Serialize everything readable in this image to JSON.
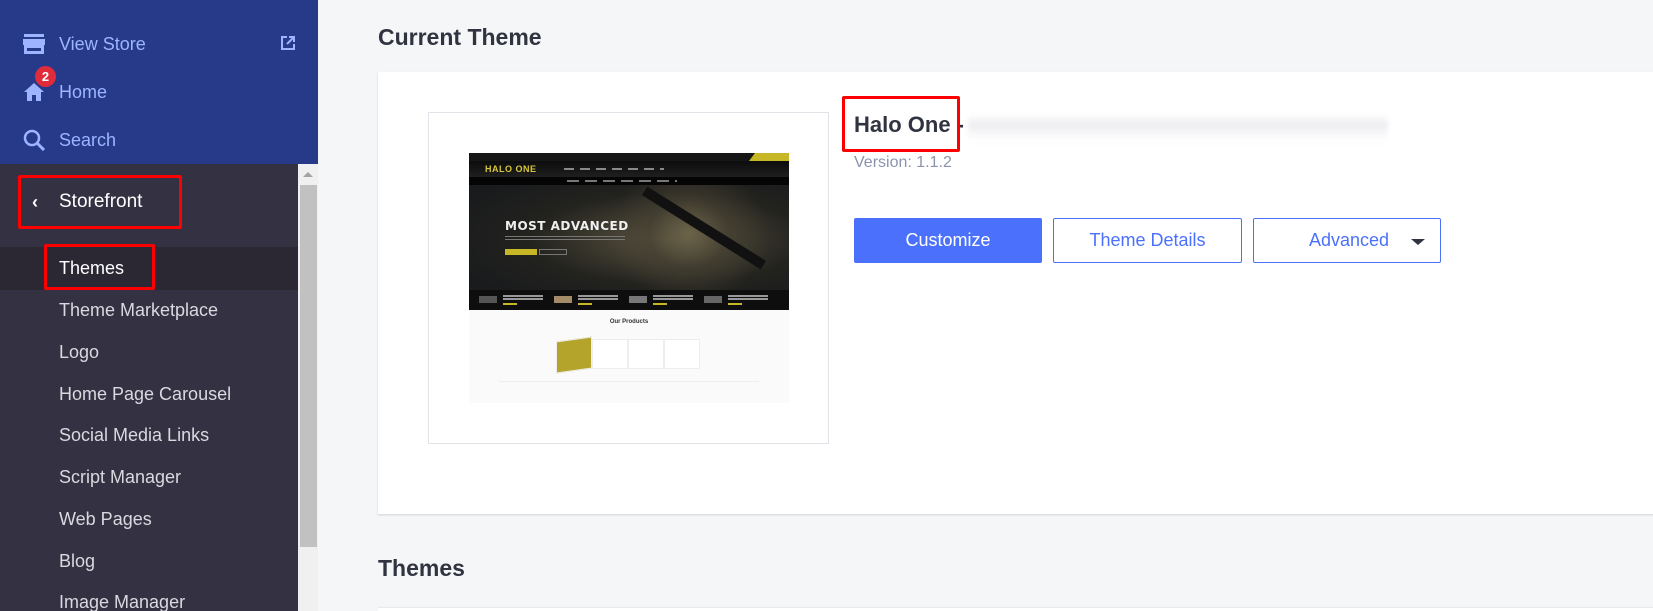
{
  "sidebar": {
    "top_items": [
      {
        "label": "View Store",
        "icon": "store-icon",
        "trailing_icon": "external-link-icon"
      },
      {
        "label": "Home",
        "icon": "home-icon",
        "badge": "2"
      },
      {
        "label": "Search",
        "icon": "search-icon"
      }
    ],
    "section": {
      "label": "Storefront",
      "back_icon": "chevron-left-icon"
    },
    "items": [
      {
        "label": "Themes",
        "active": true
      },
      {
        "label": "Theme Marketplace"
      },
      {
        "label": "Logo"
      },
      {
        "label": "Home Page Carousel"
      },
      {
        "label": "Social Media Links"
      },
      {
        "label": "Script Manager"
      },
      {
        "label": "Web Pages"
      },
      {
        "label": "Blog"
      },
      {
        "label": "Image Manager"
      }
    ]
  },
  "main": {
    "current_theme_title": "Current Theme",
    "themes_title": "Themes",
    "theme": {
      "name": "Halo One -",
      "version": "Version: 1.1.2",
      "preview": {
        "logo": "HALO ONE",
        "headline": "MOST ADVANCED",
        "section_title": "Our Products"
      }
    },
    "buttons": {
      "customize": "Customize",
      "theme_details": "Theme Details",
      "advanced": "Advanced"
    }
  },
  "colors": {
    "sidebar_top": "#273a8a",
    "sidebar": "#343142",
    "accent": "#4b71fc",
    "highlight": "#ff0000",
    "badge": "#e02b3b"
  }
}
